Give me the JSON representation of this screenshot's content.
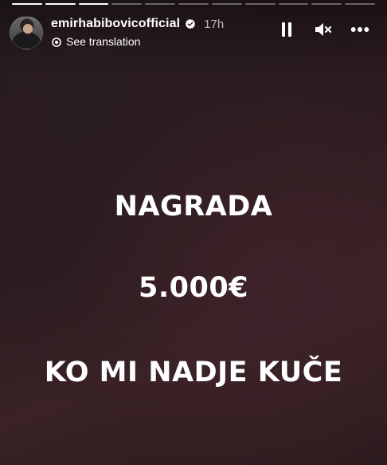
{
  "story": {
    "progress": [
      1,
      1,
      1,
      0,
      0,
      0,
      0,
      0,
      0,
      0,
      0
    ],
    "progress_current_fill": 1,
    "username": "emirhabibovicofficial",
    "verified": true,
    "time": "17h",
    "translate_label": "See translation",
    "controls": {
      "pause_icon": "pause-icon",
      "mute_icon": "speaker-muted-icon",
      "more_icon": "more-options-icon"
    },
    "text_lines": [
      "NAGRADA",
      "5.000€",
      "KO MI NADJE KUČE"
    ]
  },
  "colors": {
    "background": "#2d1c20",
    "verified_badge": "#ffffff",
    "text": "#ffffff"
  }
}
